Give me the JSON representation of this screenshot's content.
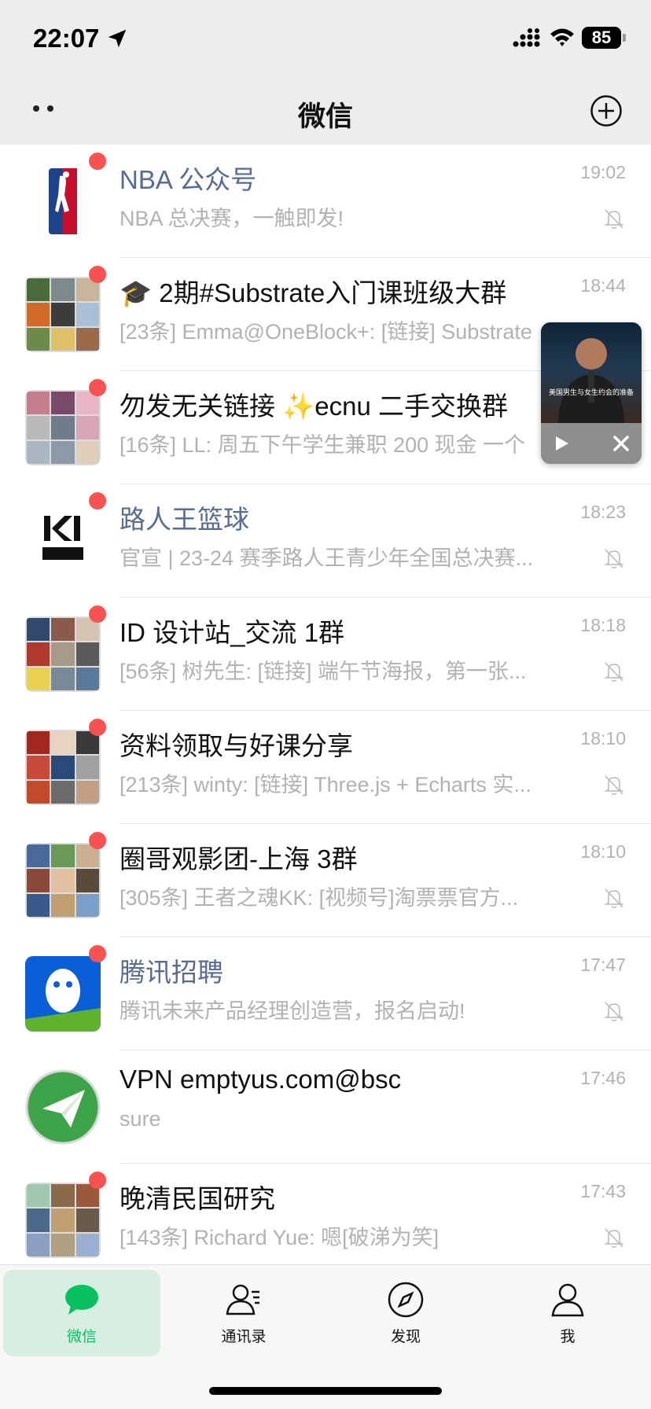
{
  "status_bar": {
    "time": "22:07",
    "battery": "85"
  },
  "nav": {
    "title": "微信"
  },
  "chats": [
    {
      "name": "NBA 公众号",
      "time": "19:02",
      "preview": "NBA 总决赛，一触即发!",
      "unread": true,
      "muted": true,
      "official": true,
      "avatar": "nba-logo"
    },
    {
      "name": "🎓 2期#Substrate入门课班级大群",
      "time": "18:44",
      "preview": "[23条] Emma@OneBlock+: [链接] Substrate",
      "unread": true,
      "muted": true,
      "official": false,
      "avatar": "group-grid"
    },
    {
      "name": "勿发无关链接 ✨ecnu 二手交换群",
      "time": "",
      "preview": "[16条] LL: 周五下午学生兼职 200 现金 一个",
      "unread": true,
      "muted": true,
      "official": false,
      "avatar": "group-grid"
    },
    {
      "name": "路人王篮球",
      "time": "18:23",
      "preview": "官宣 | 23-24 赛季路人王青少年全国总决赛...",
      "unread": true,
      "muted": true,
      "official": true,
      "avatar": "lurenwang-logo"
    },
    {
      "name": "ID 设计站_交流 1群",
      "time": "18:18",
      "preview": "[56条] 树先生: [链接] 端午节海报，第一张...",
      "unread": true,
      "muted": true,
      "official": false,
      "avatar": "group-grid"
    },
    {
      "name": "资料领取与好课分享",
      "time": "18:10",
      "preview": "[213条] winty: [链接] Three.js + Echarts 实...",
      "unread": true,
      "muted": true,
      "official": false,
      "avatar": "group-grid"
    },
    {
      "name": "圈哥观影团-上海 3群",
      "time": "18:10",
      "preview": "[305条] 王者之魂KK: [视频号]淘票票官方...",
      "unread": true,
      "muted": true,
      "official": false,
      "avatar": "group-grid"
    },
    {
      "name": "腾讯招聘",
      "time": "17:47",
      "preview": "腾讯未来产品经理创造营，报名启动!",
      "unread": true,
      "muted": true,
      "official": true,
      "avatar": "tencent-hr-logo"
    },
    {
      "name": "VPN emptyus.com@bsc",
      "time": "17:46",
      "preview": "sure",
      "unread": false,
      "muted": false,
      "official": false,
      "avatar": "paper-plane-logo"
    },
    {
      "name": "晚清民国研究",
      "time": "17:43",
      "preview": "[143条] Richard Yue: 嗯[破涕为笑]",
      "unread": true,
      "muted": true,
      "official": false,
      "avatar": "group-grid"
    }
  ],
  "float_video": {
    "caption": "美国男生与女生约会的准备"
  },
  "tabs": [
    {
      "label": "微信",
      "active": true,
      "icon": "chat-icon"
    },
    {
      "label": "通讯录",
      "active": false,
      "icon": "contacts-icon"
    },
    {
      "label": "发现",
      "active": false,
      "icon": "compass-icon"
    },
    {
      "label": "我",
      "active": false,
      "icon": "person-icon"
    }
  ],
  "colors": {
    "accent": "#07c160",
    "unread_dot": "#fa5151",
    "official_name": "#576b95",
    "muted_text": "#b2b2b2"
  }
}
